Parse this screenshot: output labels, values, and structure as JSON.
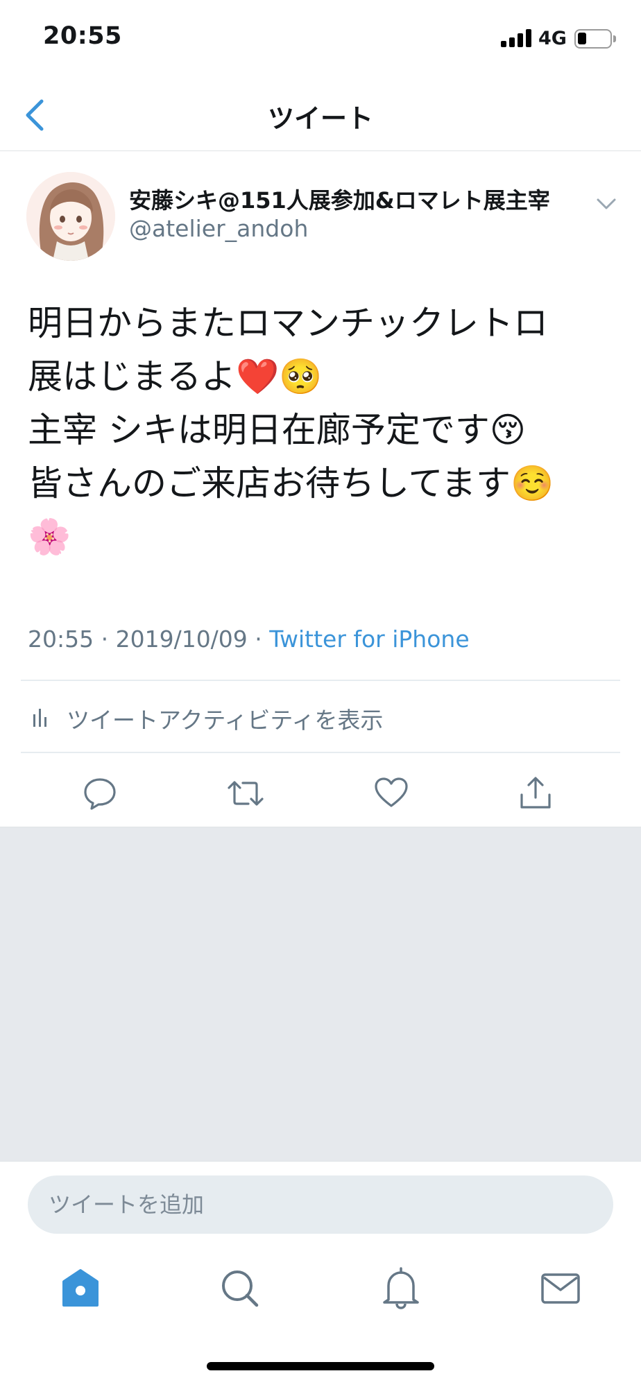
{
  "status_bar": {
    "time": "20:55",
    "network": "4G",
    "battery_level": 0.25
  },
  "nav": {
    "title": "ツイート",
    "back_icon": "chevron-left-icon"
  },
  "tweet": {
    "author": {
      "display_name": "安藤シキ@151人展参加&ロマレト展主宰",
      "handle": "@atelier_andoh"
    },
    "text_lines": [
      "明日からまたロマンチックレトロ",
      "展はじまるよ❤️🥺",
      "主宰 シキは明日在廊予定です😚",
      "皆さんのご来店お待ちしてます☺️",
      "🌸"
    ],
    "time": "20:55",
    "date": "2019/10/09",
    "separator": " · ",
    "source": "Twitter for iPhone",
    "activity_label": "ツイートアクティビティを表示",
    "actions": [
      "reply-icon",
      "retweet-icon",
      "like-icon",
      "share-icon"
    ]
  },
  "reply": {
    "placeholder": "ツイートを追加"
  },
  "tab_bar": {
    "tabs": [
      "home-icon",
      "search-icon",
      "bell-icon",
      "mail-icon"
    ],
    "active_tab": "home-icon"
  },
  "colors": {
    "accent": "#3b94d9",
    "muted_text": "#657786",
    "gray_background": "#e6e9ed"
  }
}
